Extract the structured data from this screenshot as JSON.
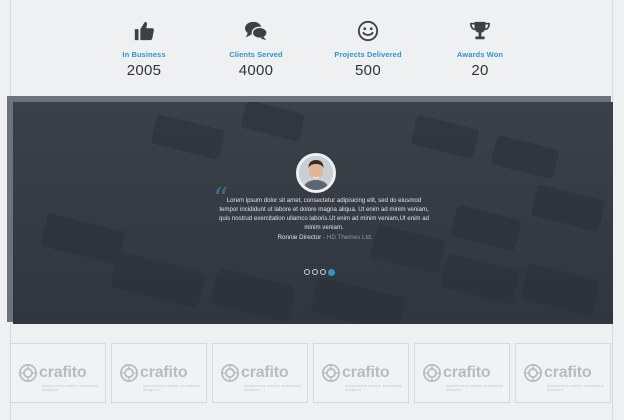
{
  "stats": [
    {
      "icon": "thumbs-up-icon",
      "label": "In Business",
      "value": "2005"
    },
    {
      "icon": "chat-bubbles-icon",
      "label": "Clients Served",
      "value": "4000"
    },
    {
      "icon": "smiley-icon",
      "label": "Projects Delivered",
      "value": "500"
    },
    {
      "icon": "trophy-icon",
      "label": "Awards Won",
      "value": "20"
    }
  ],
  "testimonial": {
    "quote_mark": "“",
    "text": "Lorem ipsum dolor sit amet, consectetur adipisicing elit, sed do eiusmod tempor incididunt ut labore et dolore magna aliqua. Ut enim ad minim veniam, quis nostrud exercitation ullamco laboris.Ut enim ad minim veniam,Ut enim ad minim veniam.",
    "author_name": "Ronnie Director",
    "author_separator": " - ",
    "author_company": "HD Themes Ltd.",
    "slides": 4,
    "active_slide": 4
  },
  "logos": [
    {
      "word": "crafito",
      "tagline": "passionately crafted, seamlessly designed"
    },
    {
      "word": "crafito",
      "tagline": "passionately crafted, seamlessly designed"
    },
    {
      "word": "crafito",
      "tagline": "passionately crafted, seamlessly designed"
    },
    {
      "word": "crafito",
      "tagline": "passionately crafted, seamlessly designed"
    },
    {
      "word": "crafito",
      "tagline": "passionately crafted, seamlessly designed"
    },
    {
      "word": "crafito",
      "tagline": "passionately crafted, seamlessly designed"
    }
  ],
  "colors": {
    "accent": "#2f95c8",
    "panel": "#363c44",
    "background": "#eef0f2"
  }
}
